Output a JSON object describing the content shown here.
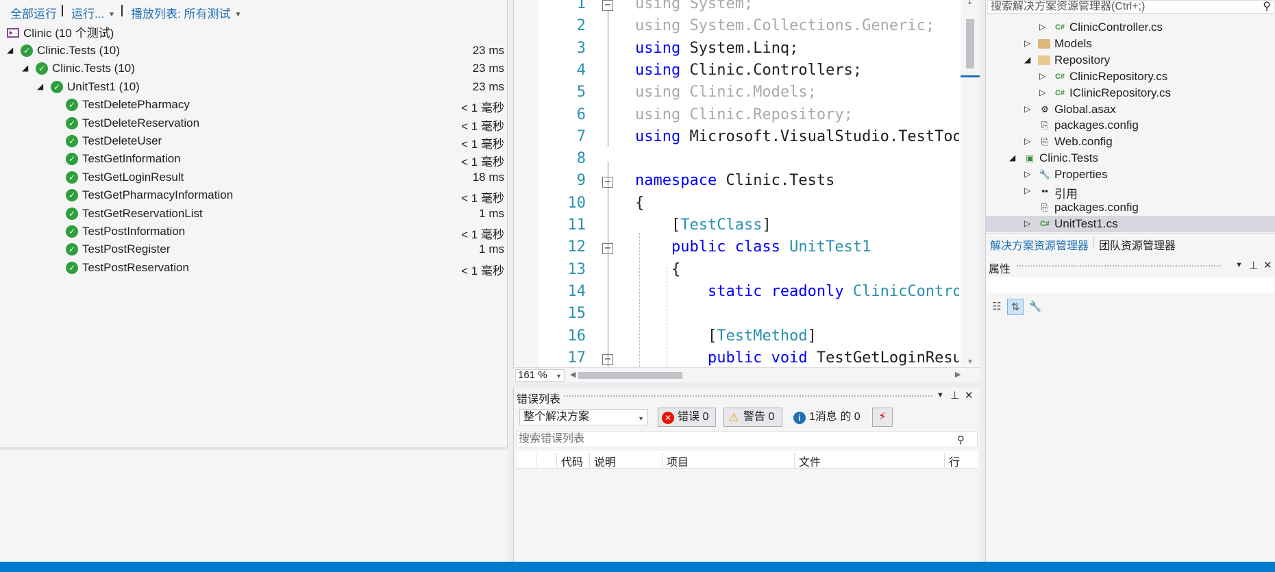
{
  "test_explorer": {
    "toolbar": {
      "run_all": "全部运行",
      "run": "运行...",
      "playlist": "播放列表: 所有测试"
    },
    "summary": "Clinic (10 个测试)",
    "tree": [
      {
        "name": "Clinic.Tests (10)",
        "duration": "23 ms",
        "level": 0,
        "expander": "◢"
      },
      {
        "name": "Clinic.Tests (10)",
        "duration": "23 ms",
        "level": 1,
        "expander": "◢"
      },
      {
        "name": "UnitTest1 (10)",
        "duration": "23 ms",
        "level": 2,
        "expander": "◢"
      },
      {
        "name": "TestDeletePharmacy",
        "duration": "< 1 毫秒",
        "level": 3,
        "expander": ""
      },
      {
        "name": "TestDeleteReservation",
        "duration": "< 1 毫秒",
        "level": 3,
        "expander": ""
      },
      {
        "name": "TestDeleteUser",
        "duration": "< 1 毫秒",
        "level": 3,
        "expander": ""
      },
      {
        "name": "TestGetInformation",
        "duration": "< 1 毫秒",
        "level": 3,
        "expander": ""
      },
      {
        "name": "TestGetLoginResult",
        "duration": "18 ms",
        "level": 3,
        "expander": ""
      },
      {
        "name": "TestGetPharmacyInformation",
        "duration": "< 1 毫秒",
        "level": 3,
        "expander": ""
      },
      {
        "name": "TestGetReservationList",
        "duration": "1 ms",
        "level": 3,
        "expander": ""
      },
      {
        "name": "TestPostInformation",
        "duration": "< 1 毫秒",
        "level": 3,
        "expander": ""
      },
      {
        "name": "TestPostRegister",
        "duration": "1 ms",
        "level": 3,
        "expander": ""
      },
      {
        "name": "TestPostReservation",
        "duration": "< 1 毫秒",
        "level": 3,
        "expander": ""
      }
    ],
    "pass_color": "#2e9f3c"
  },
  "editor": {
    "zoom": "161 %",
    "lines": [
      {
        "n": "1",
        "fold": "−",
        "tokens": [
          {
            "t": "using System;",
            "c": "g"
          }
        ]
      },
      {
        "n": "2",
        "fold": "",
        "tokens": [
          {
            "t": "using System.Collections.Generic;",
            "c": "g"
          }
        ]
      },
      {
        "n": "3",
        "fold": "",
        "tokens": [
          {
            "t": "using ",
            "c": "k"
          },
          {
            "t": "System.Linq;",
            "c": "p"
          }
        ]
      },
      {
        "n": "4",
        "fold": "",
        "tokens": [
          {
            "t": "using ",
            "c": "k"
          },
          {
            "t": "Clinic.Controllers;",
            "c": "p"
          }
        ]
      },
      {
        "n": "5",
        "fold": "",
        "tokens": [
          {
            "t": "using Clinic.Models;",
            "c": "g"
          }
        ]
      },
      {
        "n": "6",
        "fold": "",
        "tokens": [
          {
            "t": "using Clinic.Repository;",
            "c": "g"
          }
        ]
      },
      {
        "n": "7",
        "fold": "",
        "tokens": [
          {
            "t": "using ",
            "c": "k"
          },
          {
            "t": "Microsoft.VisualStudio.TestTools",
            "c": "p"
          }
        ]
      },
      {
        "n": "8",
        "fold": "",
        "tokens": []
      },
      {
        "n": "9",
        "fold": "−",
        "tokens": [
          {
            "t": "namespace ",
            "c": "k"
          },
          {
            "t": "Clinic.Tests",
            "c": "p"
          }
        ]
      },
      {
        "n": "10",
        "fold": "",
        "tokens": [
          {
            "t": "{",
            "c": "p"
          }
        ]
      },
      {
        "n": "11",
        "fold": "",
        "tokens": [
          {
            "t": "    [",
            "c": "p"
          },
          {
            "t": "TestClass",
            "c": "c"
          },
          {
            "t": "]",
            "c": "p"
          }
        ]
      },
      {
        "n": "12",
        "fold": "−",
        "tokens": [
          {
            "t": "    public class ",
            "c": "k"
          },
          {
            "t": "UnitTest1",
            "c": "c"
          }
        ]
      },
      {
        "n": "13",
        "fold": "",
        "tokens": [
          {
            "t": "    {",
            "c": "p"
          }
        ]
      },
      {
        "n": "14",
        "fold": "",
        "tokens": [
          {
            "t": "        static readonly ",
            "c": "k"
          },
          {
            "t": "ClinicControll",
            "c": "c"
          }
        ]
      },
      {
        "n": "15",
        "fold": "",
        "tokens": []
      },
      {
        "n": "16",
        "fold": "",
        "tokens": [
          {
            "t": "        [",
            "c": "p"
          },
          {
            "t": "TestMethod",
            "c": "c"
          },
          {
            "t": "]",
            "c": "p"
          }
        ]
      },
      {
        "n": "17",
        "fold": "−",
        "tokens": [
          {
            "t": "        public void ",
            "c": "k"
          },
          {
            "t": "TestGetLoginResul",
            "c": "p"
          }
        ]
      }
    ]
  },
  "error_list": {
    "title": "错误列表",
    "scope": "整个解决方案",
    "errors": "错误 0",
    "warnings": "警告 0",
    "messages": "1消息 的 0",
    "search_placeholder": "搜索错误列表",
    "columns": [
      "代码",
      "说明",
      "项目",
      "文件",
      "行"
    ]
  },
  "solution_explorer": {
    "search_placeholder": "搜索解决方案资源管理器(Ctrl+;)",
    "items": [
      {
        "name": "ClinicController.cs",
        "icon": "csharp-file-icon",
        "level": 3,
        "expander": "▷",
        "selected": false
      },
      {
        "name": "Models",
        "icon": "folder-icon",
        "level": 2,
        "expander": "▷",
        "selected": false
      },
      {
        "name": "Repository",
        "icon": "folder-open-icon",
        "level": 2,
        "expander": "◢",
        "selected": false
      },
      {
        "name": "ClinicRepository.cs",
        "icon": "csharp-file-icon",
        "level": 3,
        "expander": "▷",
        "selected": false
      },
      {
        "name": "IClinicRepository.cs",
        "icon": "csharp-file-icon",
        "level": 3,
        "expander": "▷",
        "selected": false
      },
      {
        "name": "Global.asax",
        "icon": "gear-file-icon",
        "level": 2,
        "expander": "▷",
        "selected": false
      },
      {
        "name": "packages.config",
        "icon": "config-file-icon",
        "level": 2,
        "expander": "",
        "selected": false
      },
      {
        "name": "Web.config",
        "icon": "config-file-icon",
        "level": 2,
        "expander": "▷",
        "selected": false
      },
      {
        "name": "Clinic.Tests",
        "icon": "test-project-icon",
        "level": 1,
        "expander": "◢",
        "selected": false
      },
      {
        "name": "Properties",
        "icon": "wrench-icon",
        "level": 2,
        "expander": "▷",
        "selected": false
      },
      {
        "name": "引用",
        "icon": "references-icon",
        "level": 2,
        "expander": "▷",
        "selected": false
      },
      {
        "name": "packages.config",
        "icon": "config-file-icon",
        "level": 2,
        "expander": "",
        "selected": false
      },
      {
        "name": "UnitTest1.cs",
        "icon": "csharp-file-icon",
        "level": 2,
        "expander": "▷",
        "selected": true
      }
    ],
    "tabs": [
      "解决方案资源管理器",
      "团队资源管理器"
    ],
    "accent": "#1e6fb5"
  },
  "properties": {
    "title": "属性"
  },
  "status_bar": {
    "color": "#007acc"
  }
}
